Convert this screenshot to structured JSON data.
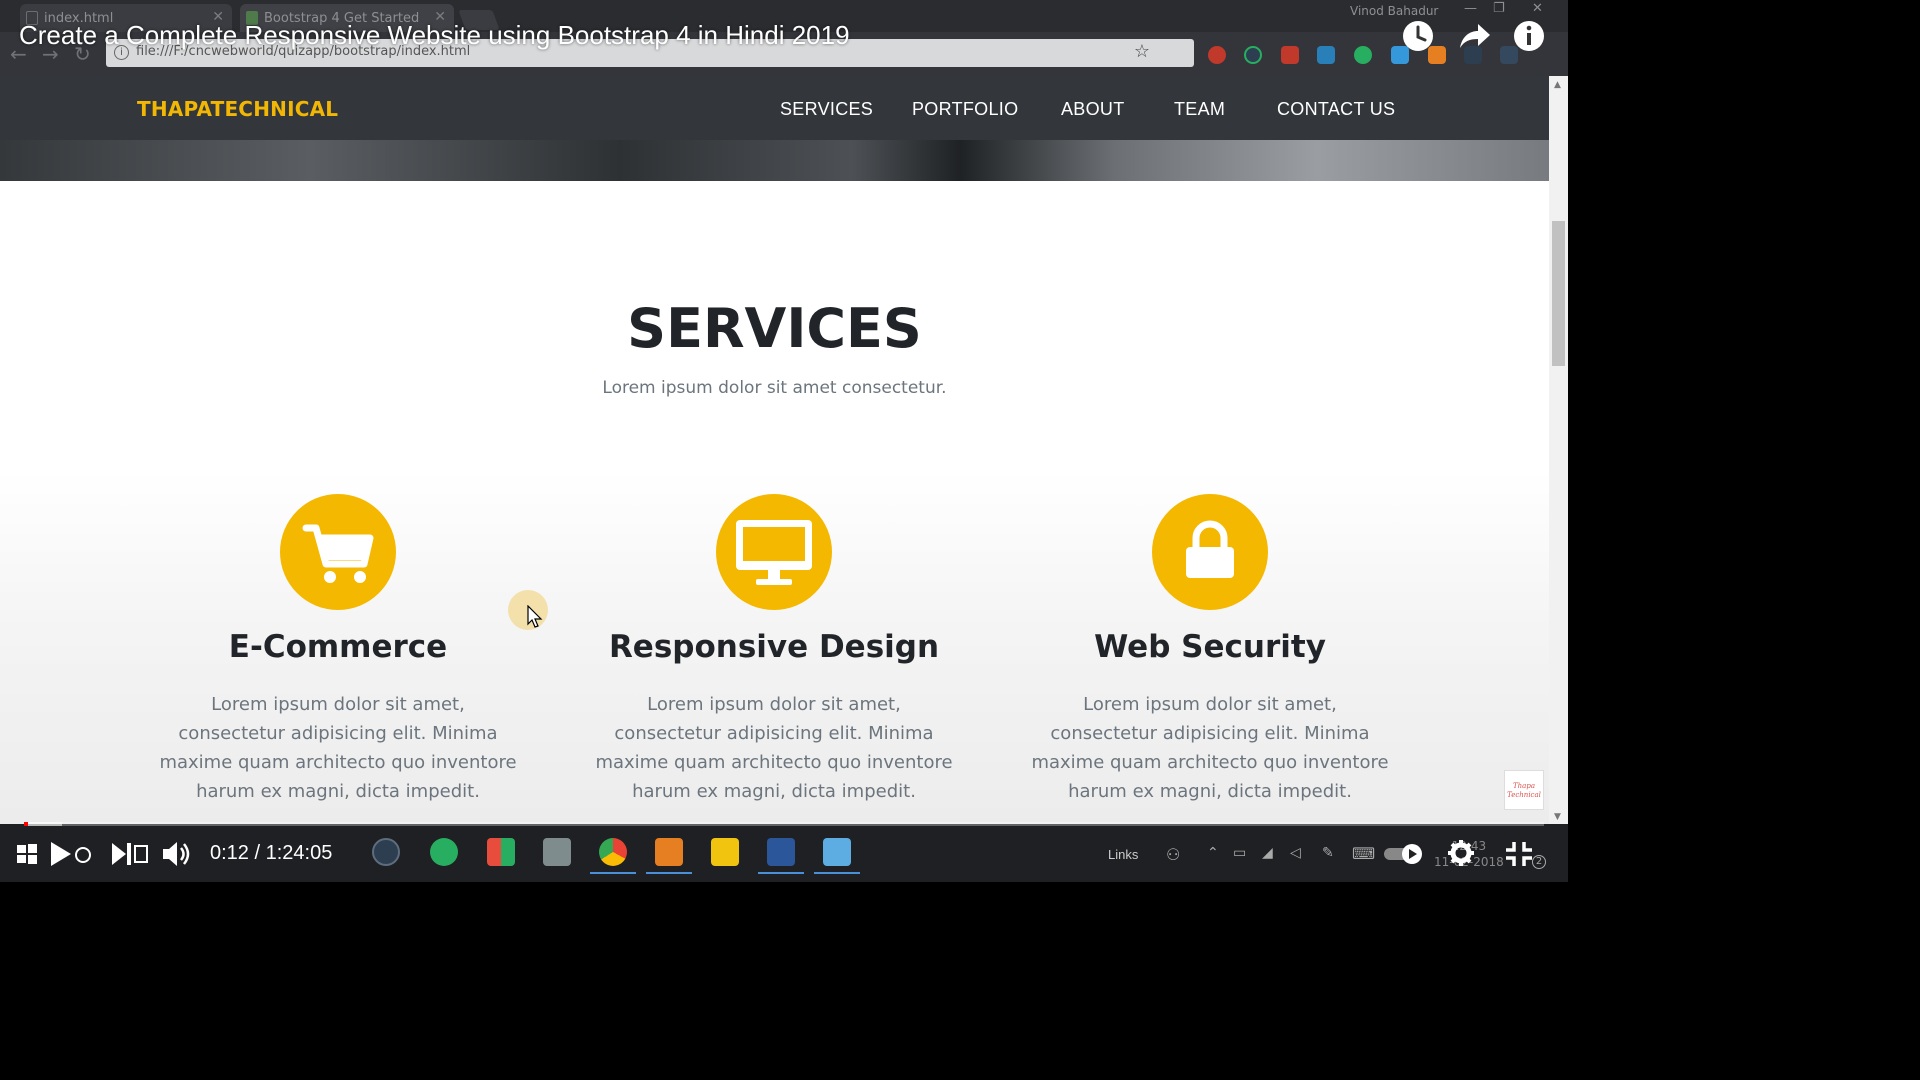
{
  "browser": {
    "tabs": [
      {
        "title": "index.html",
        "active": false
      },
      {
        "title": "Bootstrap 4 Get Started",
        "active": true
      }
    ],
    "profile_name": "Vinod Bahadur",
    "url": "file:///F:/cncwebworld/quizapp/bootstrap/index.html"
  },
  "video": {
    "title": "Create a Complete Responsive Website using Bootstrap 4 in Hindi 2019",
    "time_display": "0:12 / 1:24:05",
    "progress_fraction": 0.0024
  },
  "site": {
    "brand": "THAPATECHNICAL",
    "nav": [
      "SERVICES",
      "PORTFOLIO",
      "ABOUT",
      "TEAM",
      "CONTACT US"
    ],
    "services": {
      "heading": "SERVICES",
      "subheading": "Lorem ipsum dolor sit amet consectetur.",
      "items": [
        {
          "icon": "shopping-cart-icon",
          "title": "E-Commerce",
          "text": "Lorem ipsum dolor sit amet, consectetur adipisicing elit. Minima maxime quam architecto quo inventore harum ex magni, dicta impedit."
        },
        {
          "icon": "desktop-icon",
          "title": "Responsive Design",
          "text": "Lorem ipsum dolor sit amet, consectetur adipisicing elit. Minima maxime quam architecto quo inventore harum ex magni, dicta impedit."
        },
        {
          "icon": "lock-icon",
          "title": "Web Security",
          "text": "Lorem ipsum dolor sit amet, consectetur adipisicing elit. Minima maxime quam architecto quo inventore harum ex magni, dicta impedit."
        }
      ]
    },
    "accent_color": "#f5b800"
  },
  "taskbar": {
    "links_label": "Links",
    "clock_time": "12:43",
    "clock_date": "11-02-2018"
  }
}
